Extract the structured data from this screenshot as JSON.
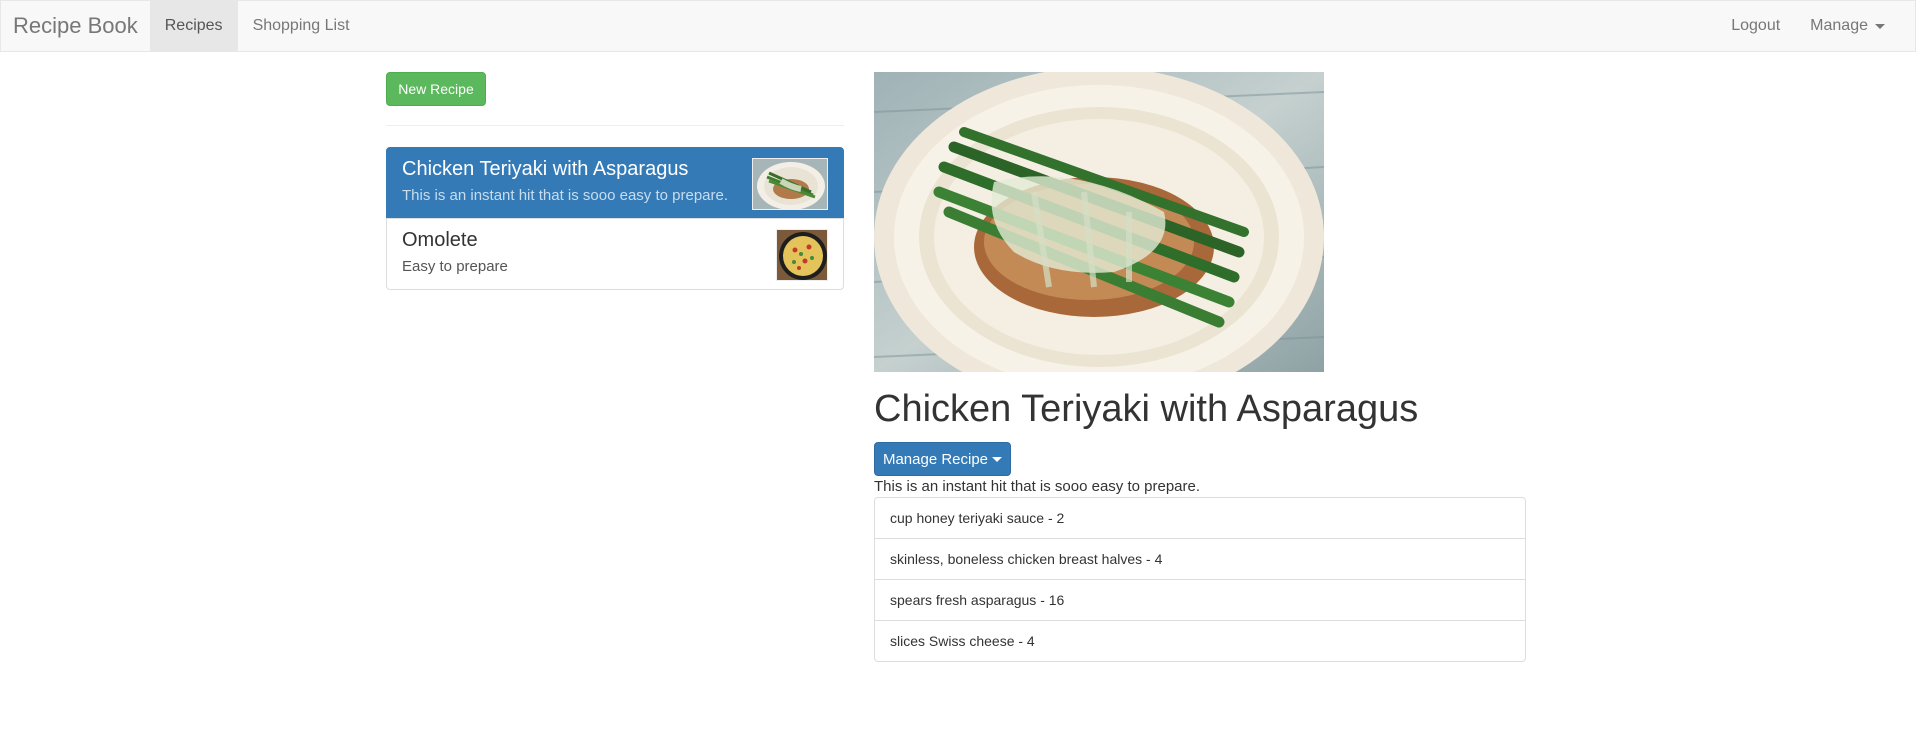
{
  "navbar": {
    "brand": "Recipe Book",
    "links": [
      {
        "label": "Recipes",
        "active": true
      },
      {
        "label": "Shopping List",
        "active": false
      }
    ],
    "logout_label": "Logout",
    "manage_label": "Manage"
  },
  "recipes_panel": {
    "new_recipe_label": "New Recipe",
    "items": [
      {
        "name": "Chicken Teriyaki with Asparagus",
        "description": "This is an instant hit that is sooo easy to prepare.",
        "active": true
      },
      {
        "name": "Omolete",
        "description": "Easy to prepare",
        "active": false
      }
    ]
  },
  "detail": {
    "title": "Chicken Teriyaki with Asparagus",
    "manage_button_label": "Manage Recipe",
    "description": "This is an instant hit that is sooo easy to prepare.",
    "ingredients": [
      "cup honey teriyaki sauce - 2",
      "skinless, boneless chicken breast halves - 4",
      "spears fresh asparagus - 16",
      "slices Swiss cheese - 4"
    ]
  },
  "colors": {
    "success": "#5cb85c",
    "primary": "#337ab7",
    "navbar_bg": "#f8f8f8"
  }
}
